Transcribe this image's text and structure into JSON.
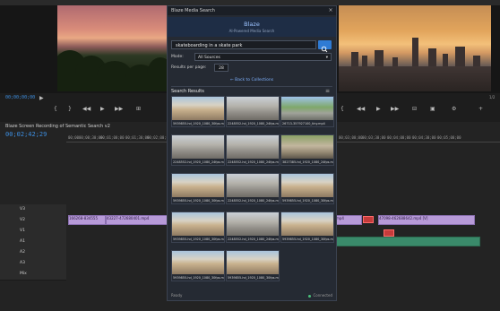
{
  "panel": {
    "tab_title": "Blaze Media Search",
    "brand_name": "Blaze",
    "brand_subtitle": "AI-Powered Media Search",
    "close_glyph": "×",
    "search": {
      "query": "skateboarding in a skate park",
      "button_icon": "search-icon"
    },
    "mode_label": "Mode:",
    "mode_value": "All Sources",
    "results_per_page_label": "Results per page:",
    "results_per_page_value": "28",
    "back_link": "← Back to Collections",
    "results_title": "Search Results",
    "results_menu": "≡",
    "results": [
      {
        "caption": "5939855-hd_1920_1080_30fps.mp4",
        "badge": "",
        "palette": "plaza"
      },
      {
        "caption": "2248552-hd_1920_1080_24fps.mp4",
        "badge": "",
        "palette": "bowl"
      },
      {
        "caption": "26713-357927100_tiny.mp4",
        "badge": "",
        "palette": "park"
      },
      {
        "caption": "2248552-hd_1920_1080_24fps.mp4",
        "badge": "",
        "palette": "bowl"
      },
      {
        "caption": "2248552-hd_1920_1080_24fps.mp4",
        "badge": "",
        "palette": "bowl"
      },
      {
        "caption": "3827385-hd_1920_1080_24fps.mp4",
        "badge": "",
        "palette": "rider"
      },
      {
        "caption": "5939855-hd_1920_1080_30fps.mp4",
        "badge": "",
        "palette": "plaza"
      },
      {
        "caption": "2248552-hd_1920_1080_24fps.mp4",
        "badge": "",
        "palette": "bowl"
      },
      {
        "caption": "5939855-hd_1920_1080_30fps.mp4",
        "badge": "",
        "palette": "plaza"
      },
      {
        "caption": "5939855-hd_1920_1080_30fps.mp4",
        "badge": "",
        "palette": "plaza"
      },
      {
        "caption": "2248552-hd_1920_1080_24fps.mp4",
        "badge": "",
        "palette": "bowl"
      },
      {
        "caption": "5939855-hd_1920_1080_30fps.mp4",
        "badge": "",
        "palette": "plaza"
      },
      {
        "caption": "5939855-hd_1920_1080_30fps.mp4",
        "badge": "",
        "palette": "plaza"
      },
      {
        "caption": "5939855-hd_1920_1080_30fps.mp4",
        "badge": "",
        "palette": "plaza"
      }
    ],
    "footer_left": "Ready",
    "footer_right": "Connected"
  },
  "source_monitor": {
    "timecode": "00;00;00;00"
  },
  "program_monitor": {
    "page": "1/2"
  },
  "timeline": {
    "sequence_name": "Blaze Screen Recording of Semantic Search v2",
    "timecode": "00;02;42;29",
    "ruler": [
      "00;00",
      "00;00;30;00",
      "00;01;00;00",
      "00;01;30;00",
      "00;02;00;00",
      "00;02;30;00",
      "00;03;00;00",
      "00;03;30;00",
      "00;04;00;00",
      "00;04;30;00",
      "00;05;00;00"
    ],
    "tracks": [
      "V3",
      "V2",
      "V1",
      "A1",
      "A2",
      "A3",
      "Mix"
    ],
    "clips": [
      {
        "label": "166268-834555",
        "color": "#b79ad8"
      },
      {
        "label": "43227-472680401.mp4",
        "color": "#b79ad8"
      },
      {
        "label": "mp4",
        "color": "#b79ad8"
      },
      {
        "label": "47098-462688642.mp4 [V]",
        "color": "#b79ad8"
      }
    ]
  },
  "colors": {
    "accent": "#2f7bd4",
    "brand": "#9cc3ff",
    "clip": "#b79ad8",
    "audio": "#3a8a6a",
    "timecode": "#3d8ee0"
  }
}
